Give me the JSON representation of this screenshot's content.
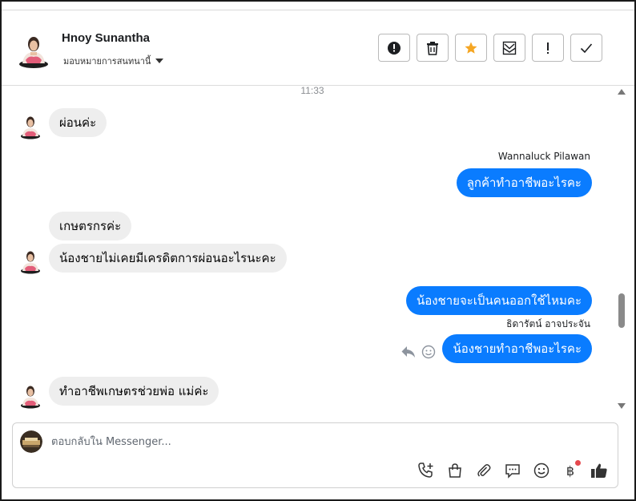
{
  "header": {
    "contact_name": "Hnoy Sunantha",
    "assign_label": "มอบหมายการสนทนานี้",
    "actions": [
      {
        "icon": "alert-circle-icon",
        "name": "mark-spam-button"
      },
      {
        "icon": "trash-icon",
        "name": "delete-button"
      },
      {
        "icon": "star-icon",
        "name": "star-button"
      },
      {
        "icon": "mark-unread-icon",
        "name": "mark-unread-button"
      },
      {
        "icon": "exclamation-icon",
        "name": "follow-up-button"
      },
      {
        "icon": "checkmark-icon",
        "name": "mark-done-button"
      }
    ],
    "star_color": "#f5a623"
  },
  "conversation": {
    "timestamp": "11:33",
    "messages": [
      {
        "direction": "in",
        "text": "ผ่อนค่ะ"
      },
      {
        "direction": "out",
        "sender": "Wannaluck Pilawan",
        "text": "ลูกค้าทำอาชีพอะไรคะ"
      },
      {
        "direction": "in",
        "text": "เกษตรกรค่ะ"
      },
      {
        "direction": "in",
        "text": "น้องชายไม่เคยมีเครดิตการผ่อนอะไรนะคะ"
      },
      {
        "direction": "out",
        "text": "น้องชายจะเป็นคนออกใช้ไหมคะ"
      },
      {
        "direction": "out",
        "sender": "ธิดารัตน์ อาจประจัน",
        "text": "น้องชายทำอาชีพอะไรคะ"
      },
      {
        "direction": "in",
        "text": "ทำอาชีพเกษตรช่วยพ่อ แม่ค่ะ"
      }
    ],
    "outgoing_color": "#0a7cff",
    "incoming_color": "#eeeeee"
  },
  "composer": {
    "placeholder": "ตอบกลับใน Messenger...",
    "icons": [
      "phone-plus-icon",
      "shopping-bag-icon",
      "paperclip-icon",
      "message-template-icon",
      "emoji-icon",
      "baht-payment-icon",
      "thumbs-up-icon"
    ],
    "baht_symbol": "฿"
  }
}
